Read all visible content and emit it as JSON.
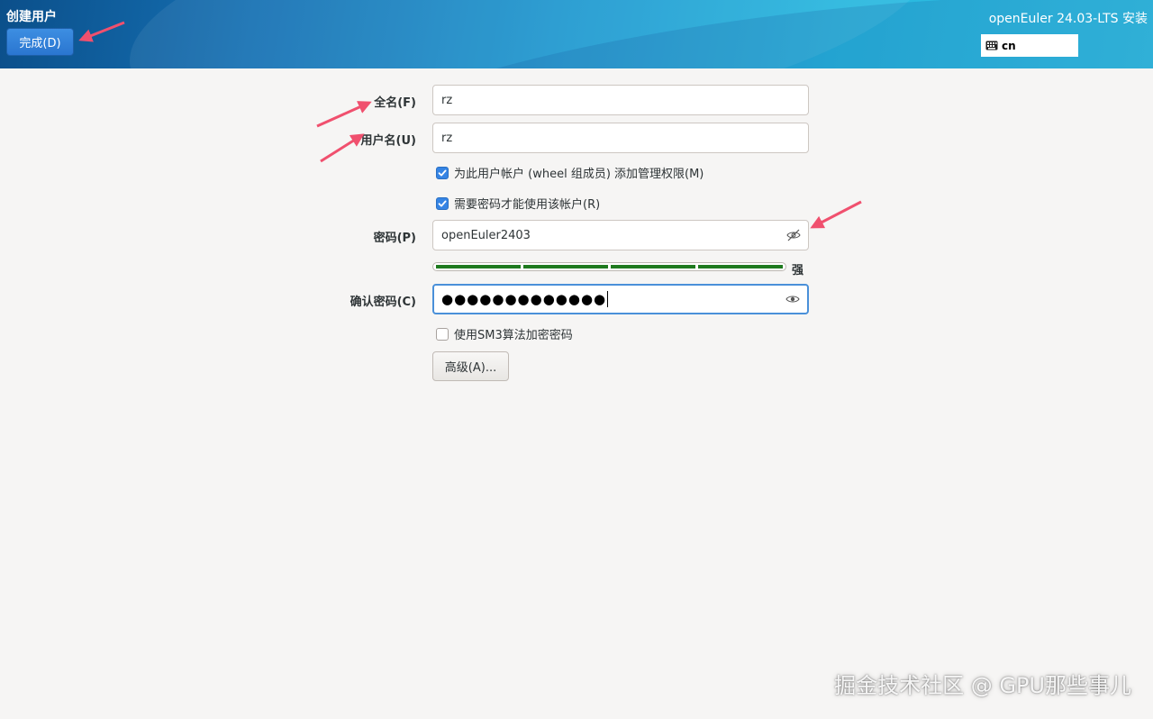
{
  "header": {
    "page_title": "创建用户",
    "done_label": "完成(D)",
    "product_title": "openEuler 24.03-LTS 安装",
    "keyboard_layout": "cn",
    "keyboard_icon": "keyboard-icon"
  },
  "form": {
    "fullname_label": "全名(F)",
    "fullname_value": "rz",
    "username_label": "用户名(U)",
    "username_value": "rz",
    "admin_checkbox_label": "为此用户帐户 (wheel 组成员) 添加管理权限(M)",
    "admin_checked": true,
    "require_password_label": "需要密码才能使用该帐户(R)",
    "require_password_checked": true,
    "password_label": "密码(P)",
    "password_value": "openEuler2403",
    "password_icon": "eye-hidden-icon",
    "strength_label": "强",
    "strength_level": 1.0,
    "confirm_label": "确认密码(C)",
    "confirm_value_masked": "●●●●●●●●●●●●●",
    "confirm_icon": "eye-icon",
    "sm3_checkbox_label": "使用SM3算法加密密码",
    "sm3_checked": false,
    "advanced_label": "高级(A)..."
  },
  "watermark": "掘金技术社区 @ GPU那些事儿",
  "colors": {
    "accent": "#3584e4",
    "annotation_arrow": "#f0506e",
    "strength": "#1f7a1f"
  }
}
